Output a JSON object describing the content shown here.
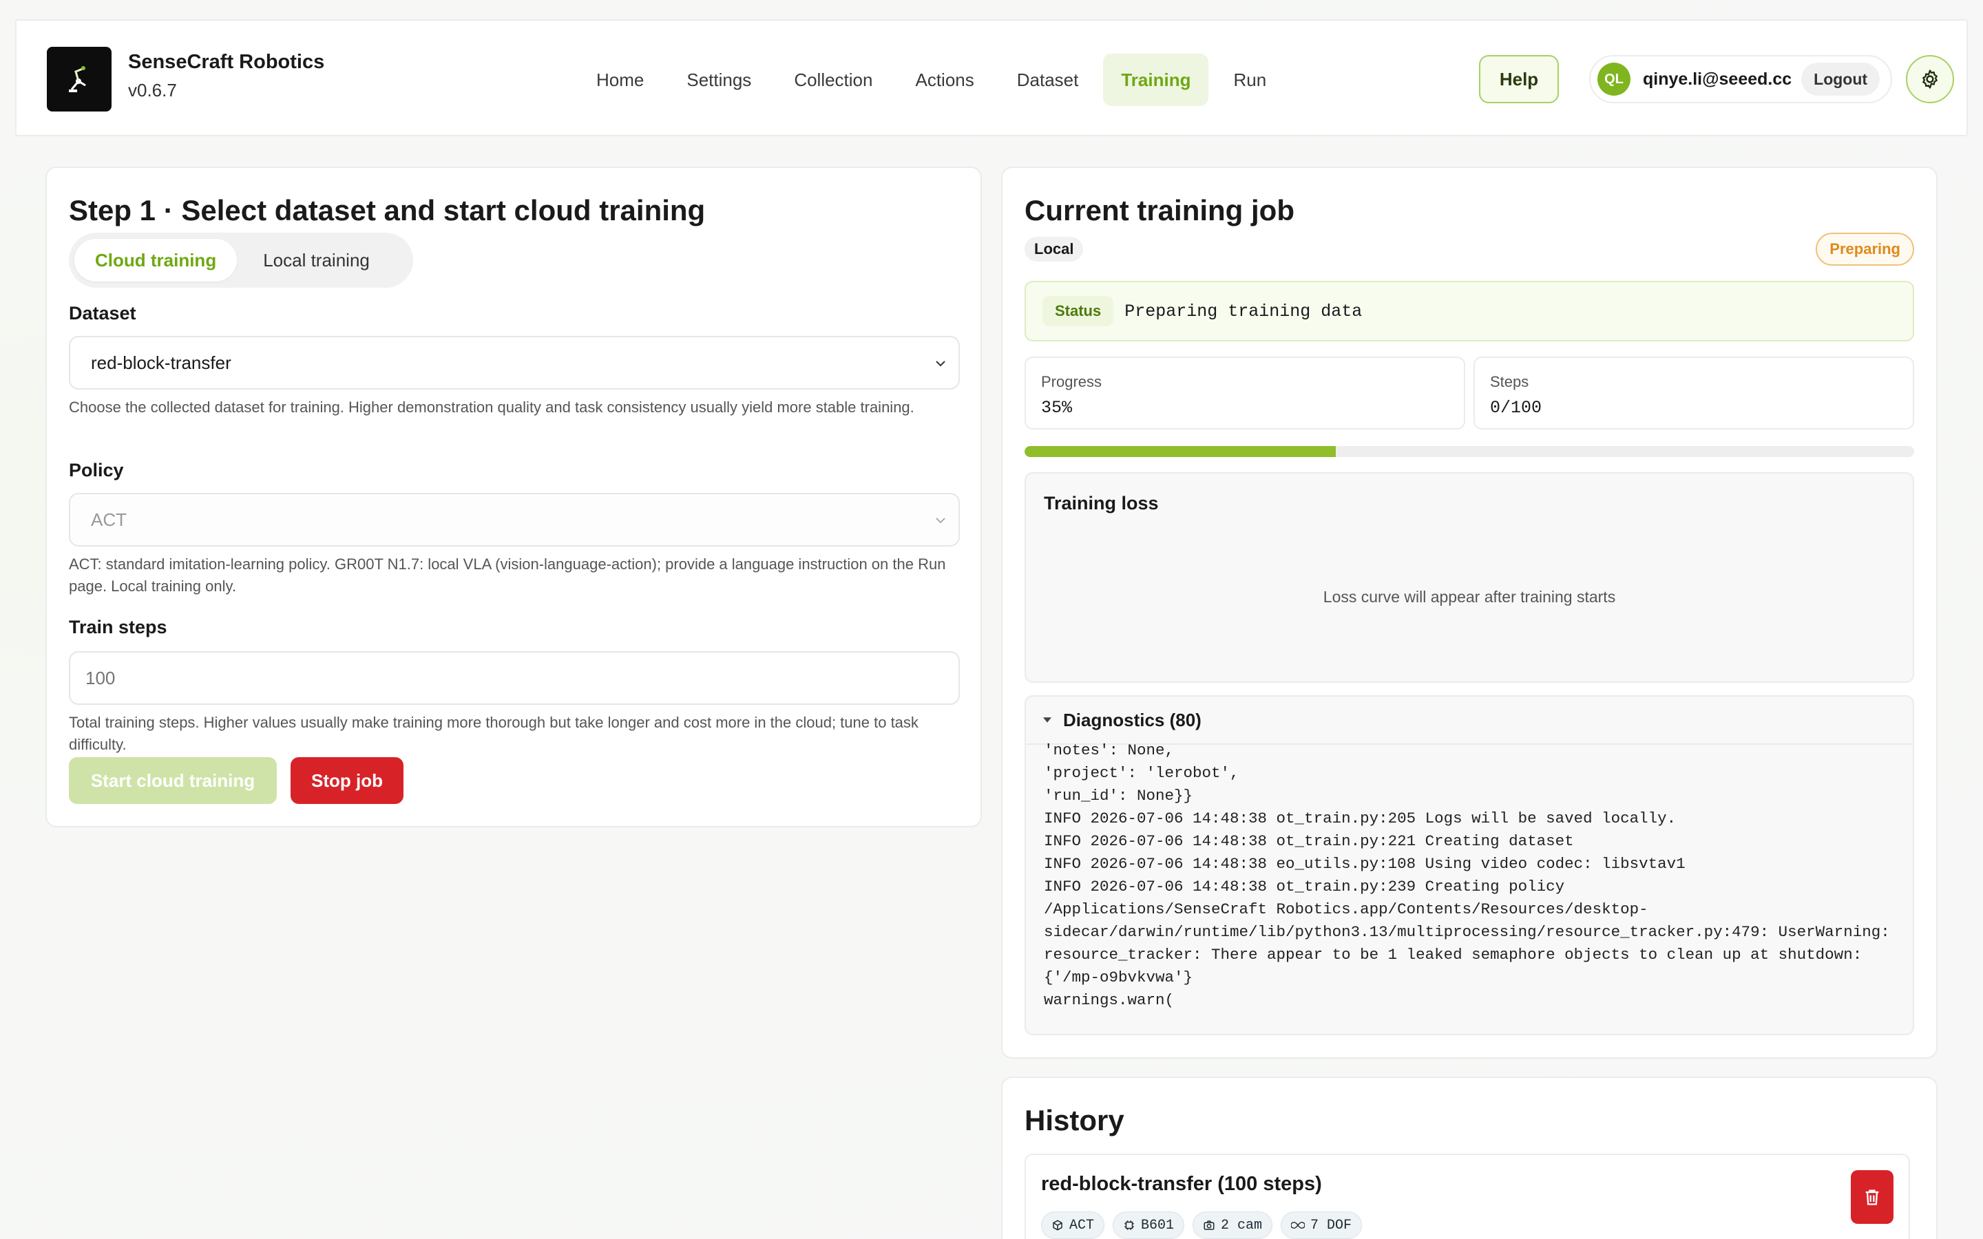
{
  "app": {
    "name": "SenseCraft Robotics",
    "version": "v0.6.7"
  },
  "nav": {
    "items": [
      {
        "label": "Home"
      },
      {
        "label": "Settings"
      },
      {
        "label": "Collection"
      },
      {
        "label": "Actions"
      },
      {
        "label": "Dataset"
      },
      {
        "label": "Training",
        "active": true
      },
      {
        "label": "Run"
      }
    ],
    "help_label": "Help"
  },
  "user": {
    "initials": "QL",
    "email": "qinye.li@seeed.cc",
    "logout_label": "Logout"
  },
  "step": {
    "title": "Step 1 · Select dataset and start cloud training",
    "tabs": [
      {
        "label": "Cloud training",
        "active": true
      },
      {
        "label": "Local training",
        "active": false
      }
    ],
    "dataset_label": "Dataset",
    "dataset_value": "red-block-transfer",
    "dataset_hint": "Choose the collected dataset for training. Higher demonstration quality and task consistency usually yield more stable training.",
    "policy_label": "Policy",
    "policy_value": "ACT",
    "policy_hint": "ACT: standard imitation-learning policy. GR00T N1.7: local VLA (vision-language-action); provide a language instruction on the Run page. Local training only.",
    "steps_label": "Train steps",
    "steps_placeholder": "100",
    "steps_hint": "Total training steps. Higher values usually make training more thorough but take longer and cost more in the cloud; tune to task difficulty.",
    "start_label": "Start cloud training",
    "stop_label": "Stop job"
  },
  "job": {
    "title": "Current training job",
    "mode_tag": "Local",
    "state_badge": "Preparing",
    "status_key": "Status",
    "status_value": "Preparing training data",
    "progress_label": "Progress",
    "progress_value": "35%",
    "progress_fraction": 0.35,
    "steps_label": "Steps",
    "steps_value": "0/100",
    "loss_title": "Training loss",
    "loss_empty": "Loss curve will appear after training starts",
    "diagnostics_title": "Diagnostics (80)",
    "log_lines": [
      "'notes': None,",
      "'project': 'lerobot',",
      "'run_id': None}}",
      "INFO 2026-07-06 14:48:38 ot_train.py:205 Logs will be saved locally.",
      "INFO 2026-07-06 14:48:38 ot_train.py:221 Creating dataset",
      "INFO 2026-07-06 14:48:38 eo_utils.py:108 Using video codec: libsvtav1",
      "INFO 2026-07-06 14:48:38 ot_train.py:239 Creating policy",
      "/Applications/SenseCraft Robotics.app/Contents/Resources/desktop-",
      "sidecar/darwin/runtime/lib/python3.13/multiprocessing/resource_tracker.py:479: UserWarning:",
      "resource_tracker: There appear to be 1 leaked semaphore objects to clean up at shutdown:",
      "{'/mp-o9bvkvwa'}",
      "warnings.warn("
    ]
  },
  "history": {
    "title": "History",
    "items": [
      {
        "name": "red-block-transfer (100 steps)",
        "tags": [
          {
            "icon": "cube-icon",
            "text": "ACT"
          },
          {
            "icon": "chip-icon",
            "text": "B601"
          },
          {
            "icon": "camera-icon",
            "text": "2 cam"
          },
          {
            "icon": "infinity-icon",
            "text": "7 DOF"
          }
        ]
      }
    ]
  },
  "colors": {
    "accent": "#6fa812",
    "progress": "#8fbe2a",
    "danger": "#d72328",
    "warning": "#e08a1a"
  }
}
